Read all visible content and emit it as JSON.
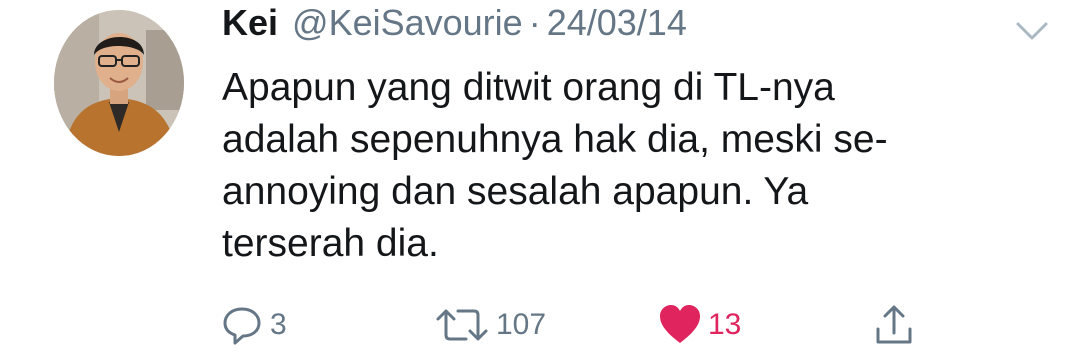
{
  "tweet": {
    "author_name": "Kei",
    "handle": "@KeiSavourie",
    "separator": "·",
    "date": "24/03/14",
    "text_lines": [
      "Apapun yang ditwit orang di TL-nya",
      "adalah sepenuhnya hak dia, meski se-",
      "annoying dan sesalah apapun. Ya",
      "terserah dia."
    ],
    "reply_count": "3",
    "retweet_count": "107",
    "like_count": "13",
    "liked": true
  },
  "colors": {
    "text": "#14171a",
    "secondary": "#657786",
    "like": "#e0245e"
  },
  "icons": [
    "chevron-down-icon",
    "reply-icon",
    "retweet-icon",
    "heart-icon",
    "share-icon"
  ]
}
